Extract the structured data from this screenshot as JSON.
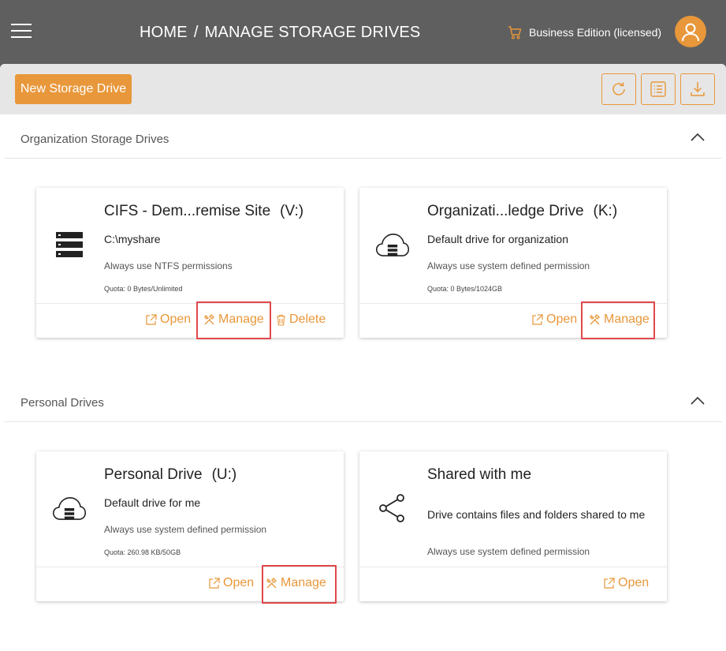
{
  "header": {
    "breadcrumb_home": "HOME",
    "breadcrumb_separator": "/",
    "breadcrumb_current": "MANAGE STORAGE DRIVES",
    "edition": "Business Edition (licensed)"
  },
  "toolbar": {
    "new_drive_label": "New Storage Drive",
    "buttons": [
      "refresh-icon",
      "list-view-icon",
      "download-icon"
    ]
  },
  "sections": [
    {
      "title": "Organization Storage Drives",
      "cards": [
        {
          "name": "CIFS - Dem...remise Site",
          "letter": "(V:)",
          "path": "C:\\myshare",
          "permission": "Always use NTFS permissions",
          "quota": "Quota: 0 Bytes/Unlimited",
          "icon": "server-stack-icon",
          "actions": [
            "Open",
            "Manage",
            "Delete"
          ]
        },
        {
          "name": "Organizati...ledge Drive",
          "letter": "(K:)",
          "path": "Default drive for organization",
          "permission": "Always use system defined permission",
          "quota": "Quota: 0 Bytes/1024GB",
          "icon": "cloud-storage-icon",
          "actions": [
            "Open",
            "Manage"
          ]
        }
      ]
    },
    {
      "title": "Personal Drives",
      "cards": [
        {
          "name": "Personal Drive",
          "letter": "(U:)",
          "path": "Default drive for me",
          "permission": "Always use system defined permission",
          "quota": "Quota: 260.98 KB/50GB",
          "icon": "cloud-storage-icon",
          "actions": [
            "Open",
            "Manage"
          ]
        },
        {
          "name": "Shared with me",
          "letter": "",
          "path": "Drive contains files and folders shared to me",
          "permission": "Always use system defined permission",
          "quota": "",
          "icon": "share-icon",
          "actions": [
            "Open"
          ]
        }
      ]
    }
  ],
  "colors": {
    "accent": "#e8973a",
    "topbar": "#5f5f5f",
    "highlight": "#e0474c"
  }
}
